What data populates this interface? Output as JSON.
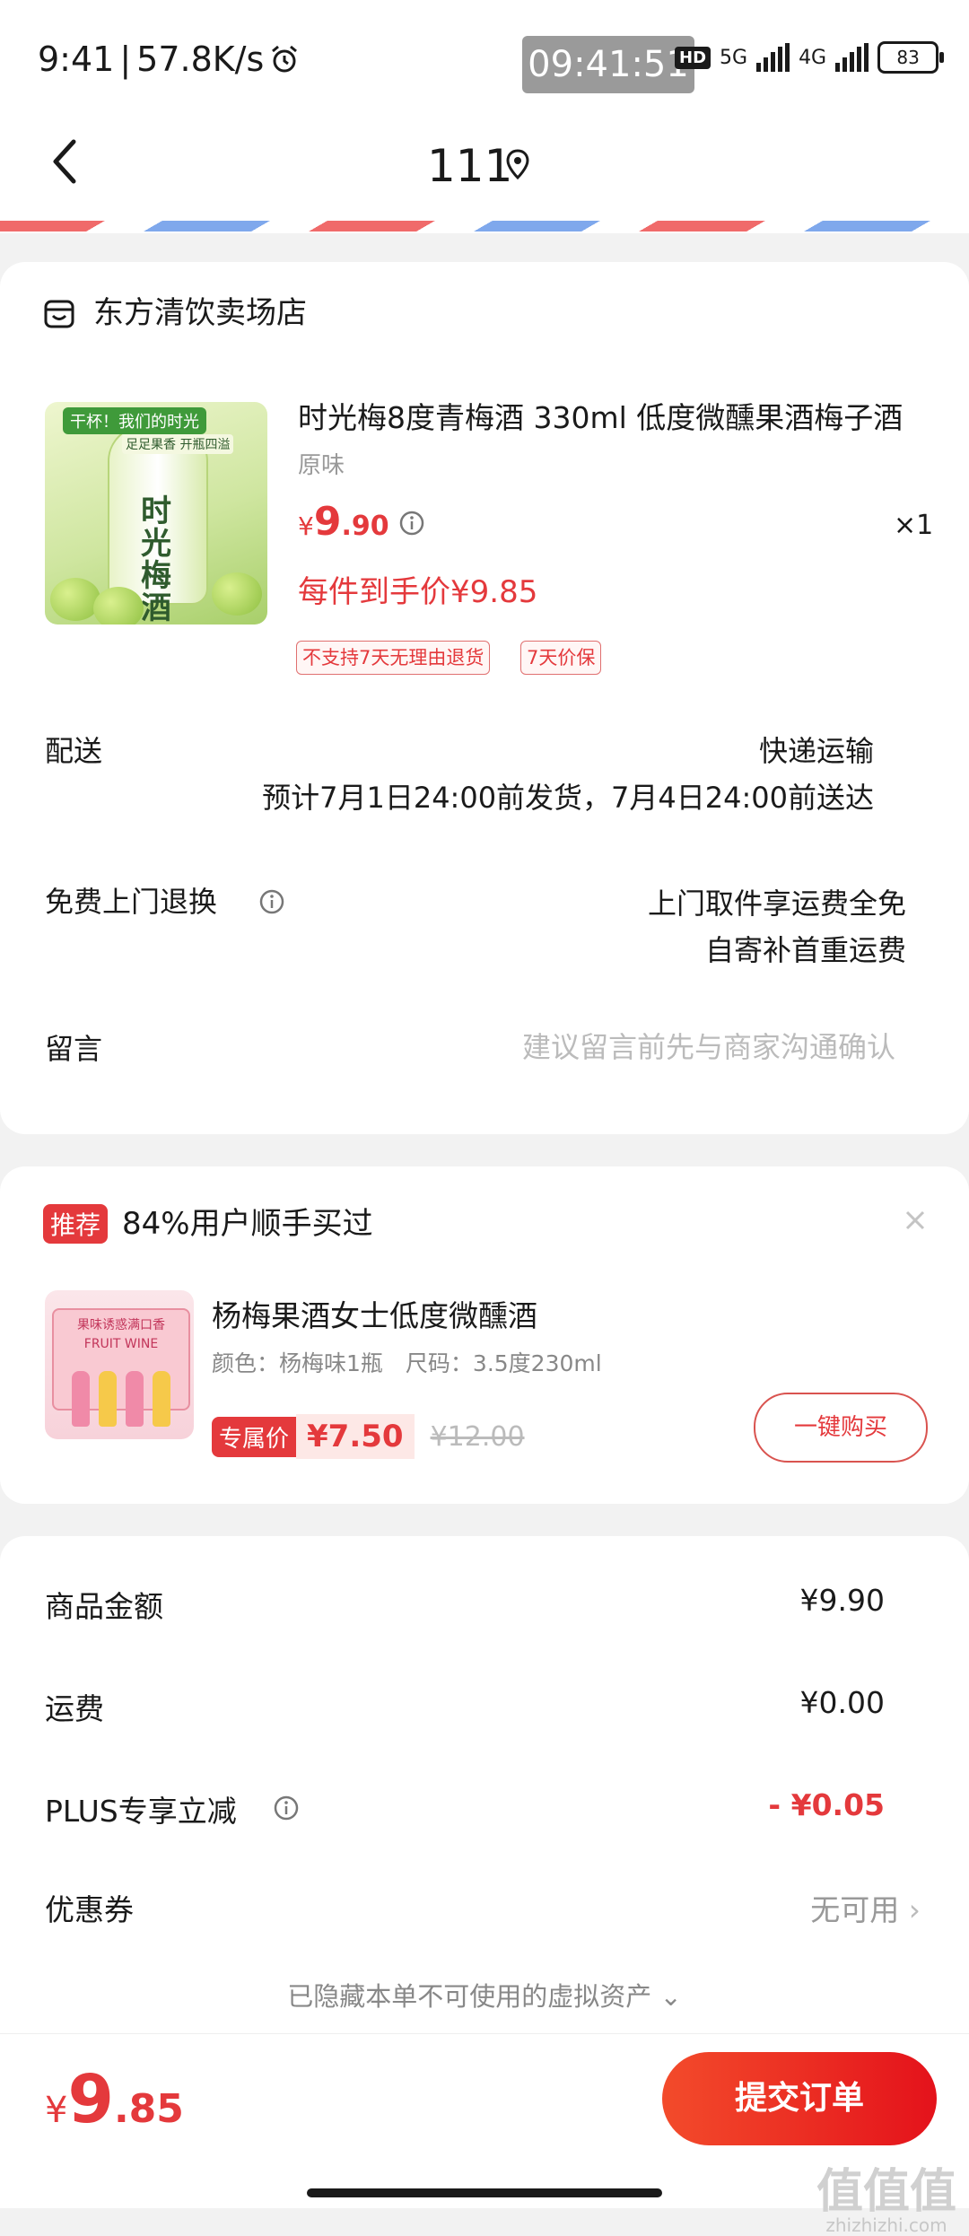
{
  "status_bar": {
    "time": "9:41",
    "net_speed": "57.8K/s",
    "clock_overlay": "09:41:51",
    "hd_label": "HD",
    "net1": "5G",
    "net2": "4G",
    "battery": "83"
  },
  "header": {
    "title": "111"
  },
  "store": {
    "name": "东方清饮卖场店"
  },
  "product": {
    "title": "时光梅8度青梅酒 330ml 低度微醺果酒梅子酒",
    "spec": "原味",
    "price_currency": "¥",
    "price_int": "9",
    "price_dec": ".90",
    "qty": "×1",
    "final_price": "每件到手价¥9.85",
    "tags": [
      "不支持7天无理由退货",
      "7天价保"
    ],
    "image_text": {
      "banner": "干杯！我们的时光",
      "sub": "足足果香 开瓶四溢",
      "label": "时光梅酒"
    }
  },
  "delivery": {
    "label": "配送",
    "method": "快递运输",
    "estimate": "预计7月1日24:00前发货，7月4日24:00前送达"
  },
  "returns": {
    "label": "免费上门退换",
    "line1": "上门取件享运费全免",
    "line2": "自寄补首重运费"
  },
  "memo": {
    "label": "留言",
    "placeholder": "建议留言前先与商家沟通确认"
  },
  "recommend": {
    "badge": "推荐",
    "title": "84%用户顺手买过",
    "item_name": "杨梅果酒女士低度微醺酒",
    "item_spec": "颜色：杨梅味1瓶　尺码：3.5度230ml",
    "price_tag": "专属价",
    "price": "¥7.50",
    "old_price": "¥12.00",
    "buy_label": "一键购买",
    "image_text": {
      "box": "果味诱惑满口香",
      "brand": "FRUIT WINE"
    }
  },
  "summary": {
    "goods_label": "商品金额",
    "goods_value": "¥9.90",
    "shipping_label": "运费",
    "shipping_value": "¥0.00",
    "plus_label": "PLUS专享立减",
    "plus_value": "- ¥0.05",
    "coupon_label": "优惠券",
    "coupon_value": "无可用",
    "coupon_chevron": "›",
    "hidden_assets": "已隐藏本单不可使用的虚拟资产 ⌄"
  },
  "footer": {
    "total_currency": "¥",
    "total_int": "9",
    "total_dec": ".85",
    "submit_label": "提交订单"
  },
  "watermark": {
    "big": "值值值",
    "small": "zhizhizhi.com"
  },
  "colors": {
    "accent": "#e4393c",
    "price_bg": "#fde8e6"
  }
}
